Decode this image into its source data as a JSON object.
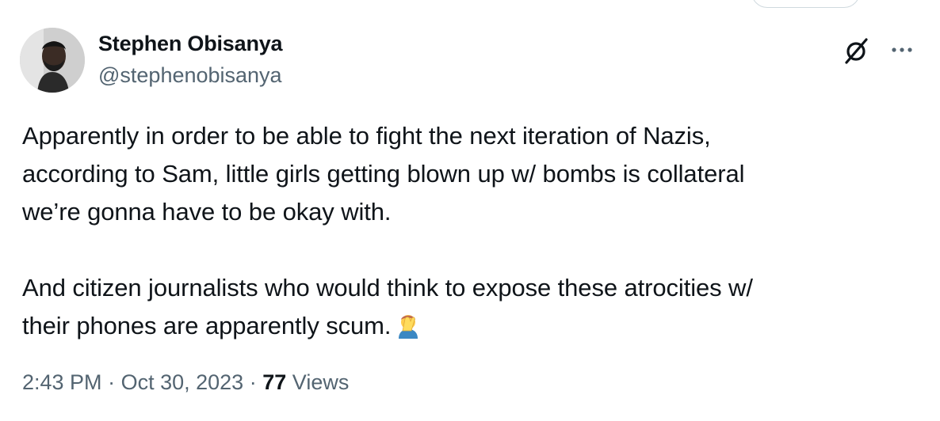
{
  "author": {
    "display_name": "Stephen Obisanya",
    "handle": "@stephenobisanya"
  },
  "tweet": {
    "paragraph1_lines": [
      "Apparently in order to be able to fight the next iteration of Nazis,",
      "according to Sam, little girls getting blown up w/ bombs is collateral",
      "we’re gonna have to be okay with."
    ],
    "paragraph2_lines": [
      "And citizen journalists who would think to expose these atrocities w/",
      "their phones are apparently scum."
    ],
    "emoji": "man-facepalming-icon"
  },
  "meta": {
    "time": "2:43 PM",
    "separator": "·",
    "date": "Oct 30, 2023",
    "views_count": "77",
    "views_label": "Views"
  },
  "icons": {
    "grok": "grok-icon",
    "more": "more-icon"
  },
  "colors": {
    "text_primary": "#0f1419",
    "text_secondary": "#536471",
    "border": "#cfd9de"
  }
}
